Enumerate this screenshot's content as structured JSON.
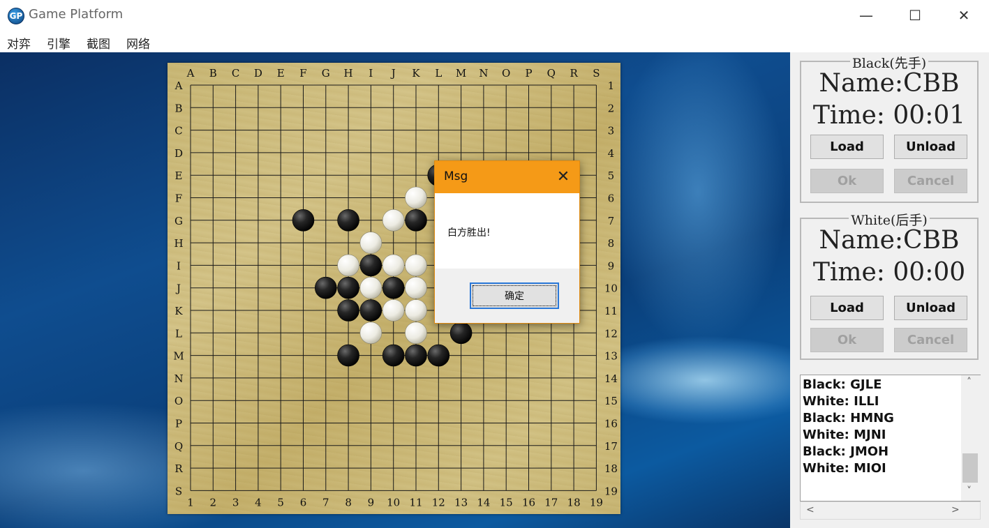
{
  "window": {
    "title": "Game Platform",
    "icon_text": "GP",
    "controls": {
      "minimize": "—",
      "maximize": "☐",
      "close": "✕"
    }
  },
  "menu": [
    "对弈",
    "引擎",
    "截图",
    "网络"
  ],
  "board": {
    "columns": [
      "A",
      "B",
      "C",
      "D",
      "E",
      "F",
      "G",
      "H",
      "I",
      "J",
      "K",
      "L",
      "M",
      "N",
      "O",
      "P",
      "Q",
      "R",
      "S"
    ],
    "rows": [
      "A",
      "B",
      "C",
      "D",
      "E",
      "F",
      "G",
      "H",
      "I",
      "J",
      "K",
      "L",
      "M",
      "N",
      "O",
      "P",
      "Q",
      "R",
      "S"
    ],
    "numbers": [
      "1",
      "2",
      "3",
      "4",
      "5",
      "6",
      "7",
      "8",
      "9",
      "10",
      "11",
      "12",
      "13",
      "14",
      "15",
      "16",
      "17",
      "18",
      "19"
    ],
    "black_stones": [
      [
        6,
        7
      ],
      [
        8,
        7
      ],
      [
        11,
        7
      ],
      [
        12,
        5
      ],
      [
        9,
        9
      ],
      [
        7,
        10
      ],
      [
        8,
        10
      ],
      [
        10,
        10
      ],
      [
        8,
        11
      ],
      [
        9,
        11
      ],
      [
        13,
        12
      ],
      [
        8,
        13
      ],
      [
        10,
        13
      ],
      [
        11,
        13
      ],
      [
        12,
        13
      ]
    ],
    "white_stones": [
      [
        11,
        6
      ],
      [
        10,
        7
      ],
      [
        9,
        8
      ],
      [
        8,
        9
      ],
      [
        10,
        9
      ],
      [
        11,
        9
      ],
      [
        9,
        10
      ],
      [
        11,
        10
      ],
      [
        10,
        11
      ],
      [
        11,
        11
      ],
      [
        9,
        12
      ],
      [
        11,
        12
      ]
    ]
  },
  "dialog": {
    "title": "Msg",
    "close_icon": "✕",
    "message": "白方胜出!",
    "ok_label": "确定"
  },
  "black_panel": {
    "legend": "Black(先手)",
    "name_line": "Name:CBB",
    "time_line": "Time: 00:01",
    "load": "Load",
    "unload": "Unload",
    "ok": "Ok",
    "cancel": "Cancel"
  },
  "white_panel": {
    "legend": "White(后手)",
    "name_line": "Name:CBB",
    "time_line": "Time: 00:00",
    "load": "Load",
    "unload": "Unload",
    "ok": "Ok",
    "cancel": "Cancel"
  },
  "move_log": [
    "Black: GJLE",
    "White: ILLI",
    "Black: HMNG",
    "White: MJNI",
    "Black: JMOH",
    "White: MIOI"
  ],
  "scroll": {
    "up": "˄",
    "down": "˅",
    "left": "<",
    "right": ">"
  }
}
